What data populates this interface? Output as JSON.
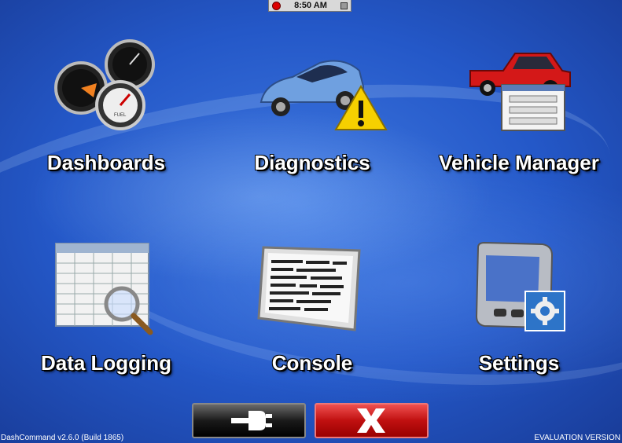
{
  "status_bar": {
    "time": "8:50 AM"
  },
  "tiles": [
    {
      "label": "Dashboards",
      "icon": "gauges-icon"
    },
    {
      "label": "Diagnostics",
      "icon": "car-warning-icon"
    },
    {
      "label": "Vehicle Manager",
      "icon": "truck-list-icon"
    },
    {
      "label": "Data Logging",
      "icon": "table-magnifier-icon"
    },
    {
      "label": "Console",
      "icon": "console-screen-icon"
    },
    {
      "label": "Settings",
      "icon": "device-gear-icon"
    }
  ],
  "buttons": {
    "connect_icon": "plug-icon",
    "exit_icon": "close-x-icon"
  },
  "footer": {
    "version": "DashCommand v2.6.0 (Build 1865)",
    "edition": "EVALUATION VERSION"
  },
  "colors": {
    "background": "#2458c8",
    "exit_button": "#c01010",
    "connect_button": "#1a1a1a"
  }
}
